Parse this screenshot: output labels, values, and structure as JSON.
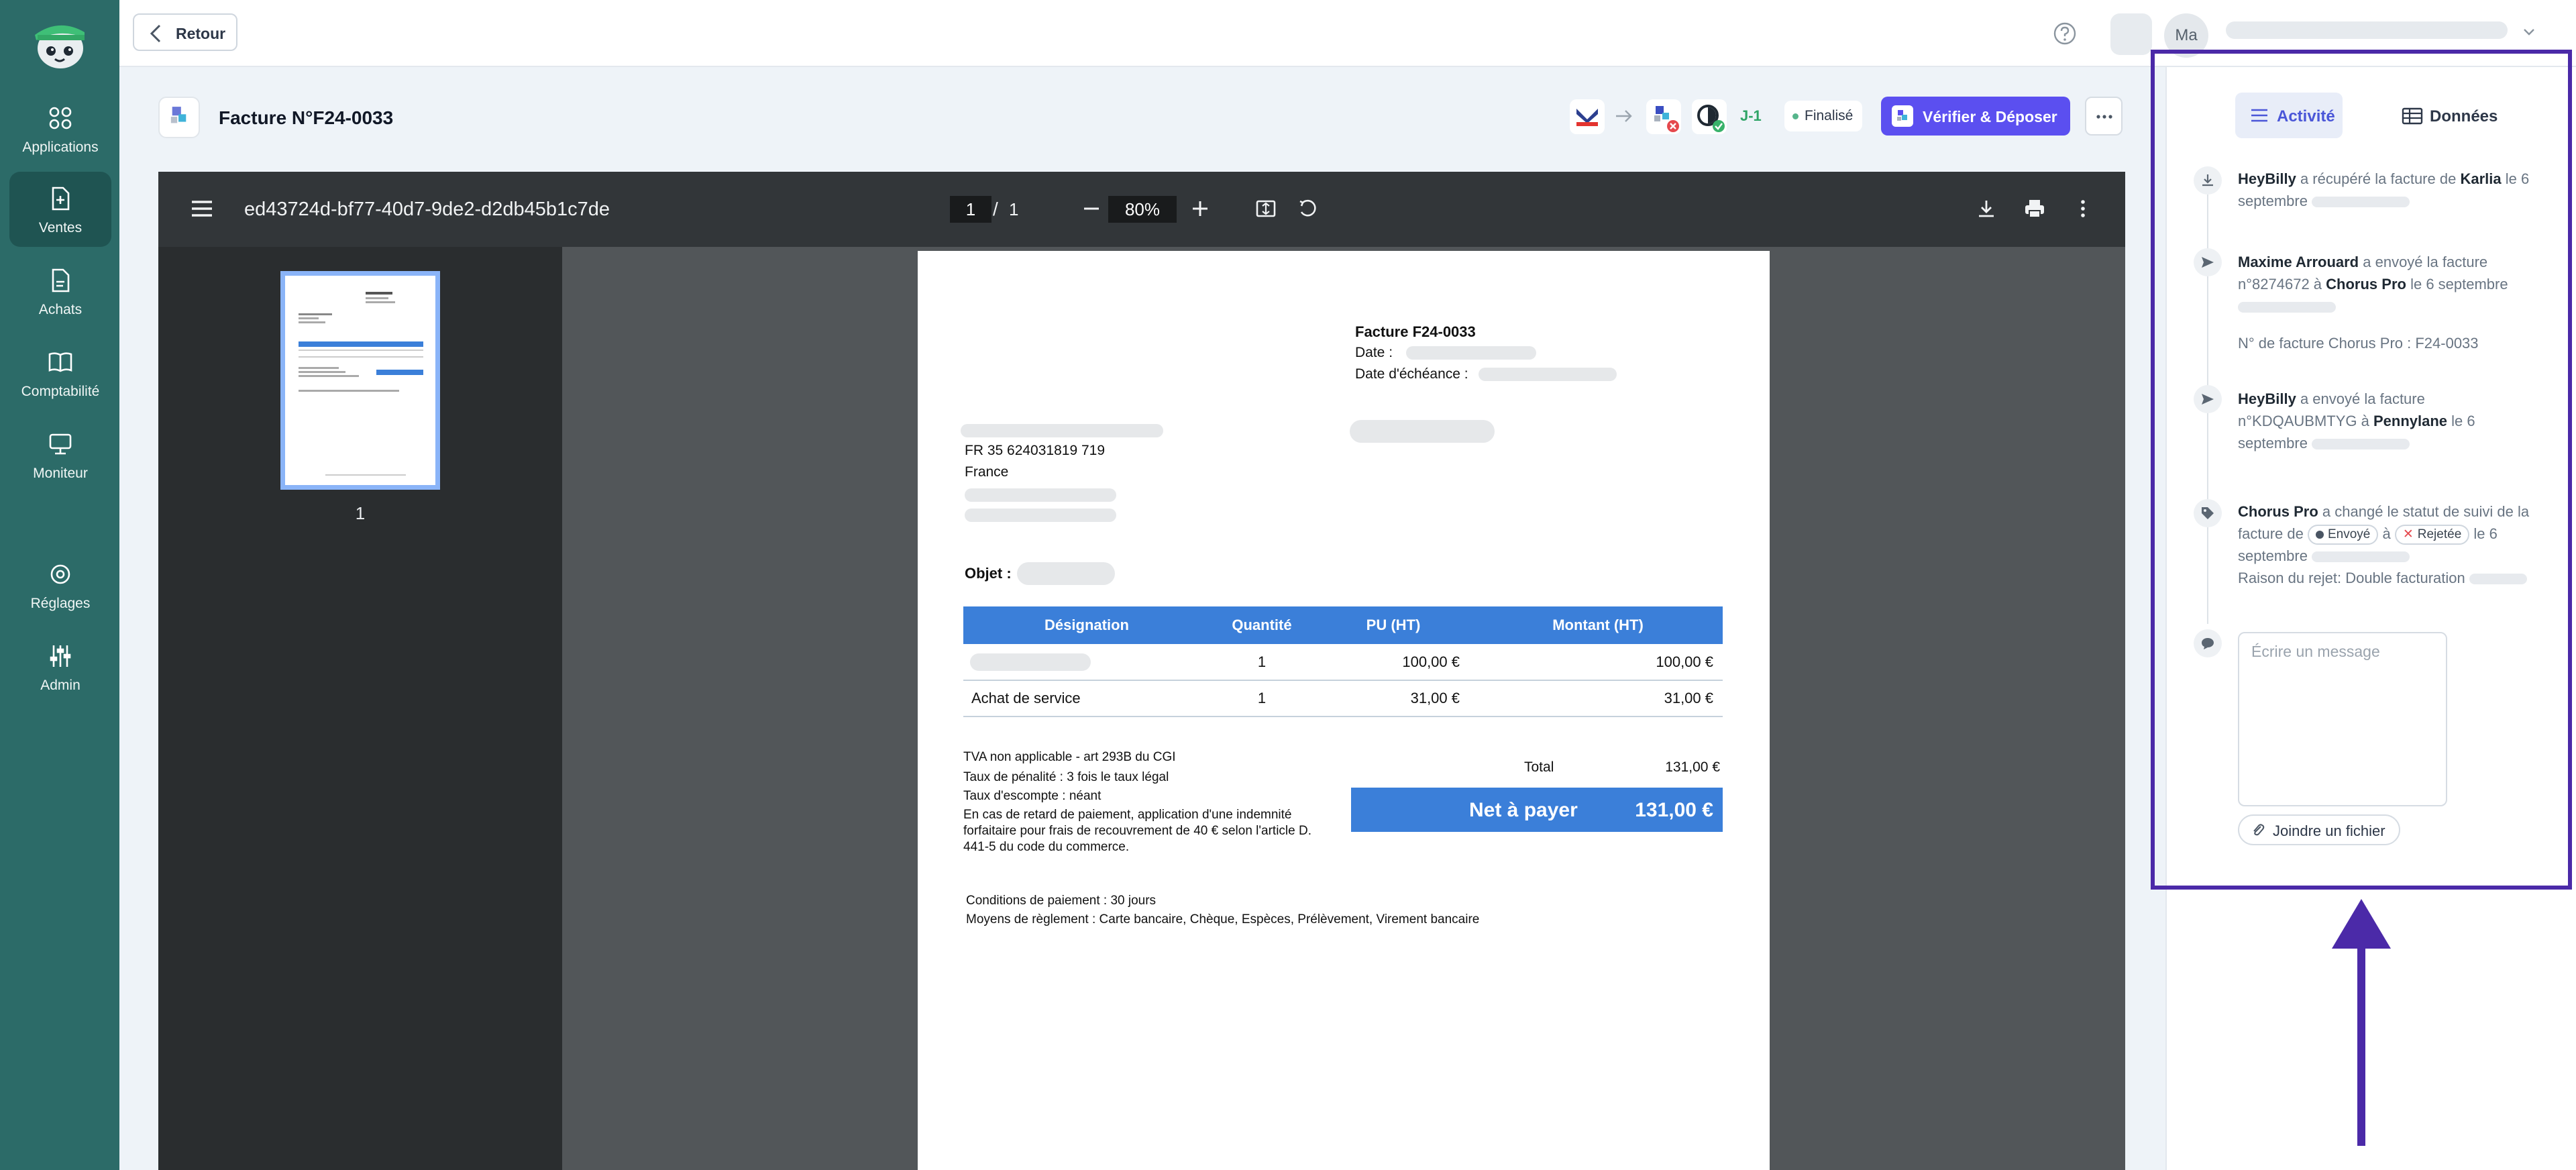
{
  "sidebar": {
    "items": [
      {
        "label": "Applications",
        "icon": "apps-grid-icon"
      },
      {
        "label": "Ventes",
        "icon": "sales-document-icon",
        "active": true
      },
      {
        "label": "Achats",
        "icon": "purchase-document-icon"
      },
      {
        "label": "Comptabilité",
        "icon": "book-icon"
      },
      {
        "label": "Moniteur",
        "icon": "monitor-icon"
      },
      {
        "label": "Réglages",
        "icon": "gear-icon"
      },
      {
        "label": "Admin",
        "icon": "sliders-icon"
      }
    ]
  },
  "topbar": {
    "back_label": "Retour",
    "avatar_initials": "Ma"
  },
  "invoice_header": {
    "title": "Facture N°F24-0033",
    "deadline": "J-1",
    "status": "Finalisé",
    "primary_action": "Vérifier & Déposer"
  },
  "viewer": {
    "file_name": "ed43724d-bf77-40d7-9de2-d2db45b1c7de",
    "current_page": "1",
    "page_separator": "/",
    "total_pages": "1",
    "zoom": "80%",
    "thumbnail_label": "1"
  },
  "document": {
    "invoice_ref": "Facture F24-0033",
    "date_label": "Date :",
    "due_date_label": "Date d'échéance :",
    "vat_number": "FR 35 624031819 719",
    "country": "France",
    "subject_label": "Objet :",
    "table": {
      "headers": [
        "Désignation",
        "Quantité",
        "PU (HT)",
        "Montant (HT)"
      ],
      "rows": [
        {
          "designation": "",
          "qty": "1",
          "unit_price": "100,00 €",
          "amount": "100,00 €"
        },
        {
          "designation": "Achat de service",
          "qty": "1",
          "unit_price": "31,00 €",
          "amount": "31,00 €"
        }
      ]
    },
    "notes": [
      "TVA non applicable - art 293B du CGI",
      "Taux de pénalité : 3 fois le taux légal",
      "Taux d'escompte : néant",
      "En cas de retard de paiement, application d'une indemnité",
      "forfaitaire pour frais de recouvrement de 40 € selon l'article D.",
      "441-5 du code du commerce."
    ],
    "total_label": "Total",
    "total_value": "131,00 €",
    "net_label": "Net à payer",
    "net_value": "131,00 €",
    "payment_terms": "Conditions de paiement : 30 jours",
    "payment_methods": "Moyens de règlement : Carte bancaire, Chèque, Espèces, Prélèvement, Virement bancaire"
  },
  "panel": {
    "tabs": {
      "activity": "Activité",
      "data": "Données"
    },
    "events": [
      {
        "actor": "HeyBilly",
        "action": "a récupéré la facture de",
        "target": "Karlia",
        "date": "le 6 septembre"
      },
      {
        "actor": "Maxime Arrouard",
        "action": "a envoyé la facture n°8274672 à",
        "target": "Chorus Pro",
        "date": "le 6 septembre",
        "detail": "N° de facture Chorus Pro : F24-0033"
      },
      {
        "actor": "HeyBilly",
        "action": "a envoyé la facture n°KDQAUBMTYG à",
        "target": "Pennylane",
        "date": "le 6 septembre"
      },
      {
        "actor": "Chorus Pro",
        "action": "a changé le statut de suivi de la facture de",
        "from_status": "Envoyé",
        "connector": "à",
        "to_status": "Rejetée",
        "date_prefix": "le",
        "date": "6 septembre",
        "reason": "Raison du rejet: Double facturation"
      }
    ],
    "message_placeholder": "Écrire un message",
    "attach_label": "Joindre un fichier"
  },
  "colors": {
    "sidebar": "#2c6b68",
    "primary": "#5b4ff0",
    "highlight": "#4b2aa8",
    "table_header": "#3b7fd9"
  }
}
